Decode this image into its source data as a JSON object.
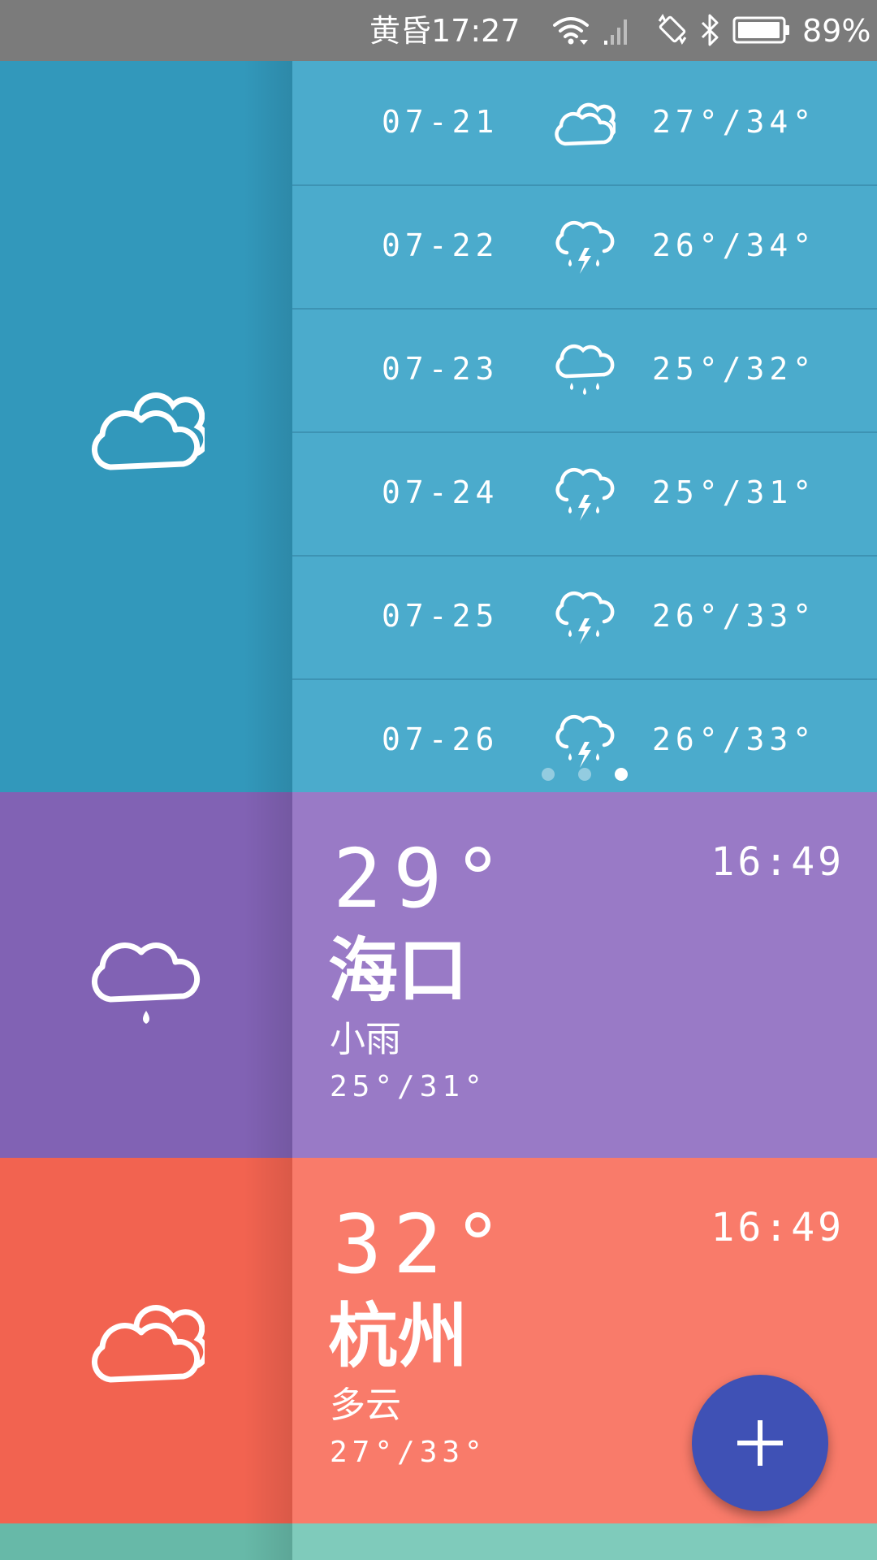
{
  "status_bar": {
    "time": "黄昏17:27",
    "battery_percent": "89%",
    "icons": [
      "wifi-icon",
      "signal-icon",
      "auto-rotate-icon",
      "bluetooth-icon",
      "battery-icon"
    ]
  },
  "forecast_card": {
    "current_icon": "cloudy-icon",
    "days": [
      {
        "date": "07-21",
        "icon": "cloudy-icon",
        "temp": "27°/34°"
      },
      {
        "date": "07-22",
        "icon": "thunderstorm-icon",
        "temp": "26°/34°"
      },
      {
        "date": "07-23",
        "icon": "rain-icon",
        "temp": "25°/32°"
      },
      {
        "date": "07-24",
        "icon": "thunderstorm-icon",
        "temp": "25°/31°"
      },
      {
        "date": "07-25",
        "icon": "thunderstorm-icon",
        "temp": "26°/33°"
      },
      {
        "date": "07-26",
        "icon": "thunderstorm-icon",
        "temp": "26°/33°"
      }
    ],
    "pager": {
      "pages": 3,
      "active": 3
    },
    "colors": {
      "side": "#3298bb",
      "main": "#4babcc"
    }
  },
  "cities": [
    {
      "name": "海口",
      "temp": "29°",
      "time": "16:49",
      "condition": "小雨",
      "range": "25°/31°",
      "icon": "light-rain-icon",
      "colors": {
        "side": "#8162b4",
        "main": "#997ac6"
      }
    },
    {
      "name": "杭州",
      "temp": "32°",
      "time": "16:49",
      "condition": "多云",
      "range": "27°/33°",
      "icon": "cloudy-icon",
      "colors": {
        "side": "#f26350",
        "main": "#f97b6a"
      }
    }
  ],
  "next_card_colors": {
    "side": "#67b9a8",
    "main": "#7fcbbb"
  },
  "fab": {
    "icon": "plus-icon",
    "color": "#3f51b5"
  }
}
